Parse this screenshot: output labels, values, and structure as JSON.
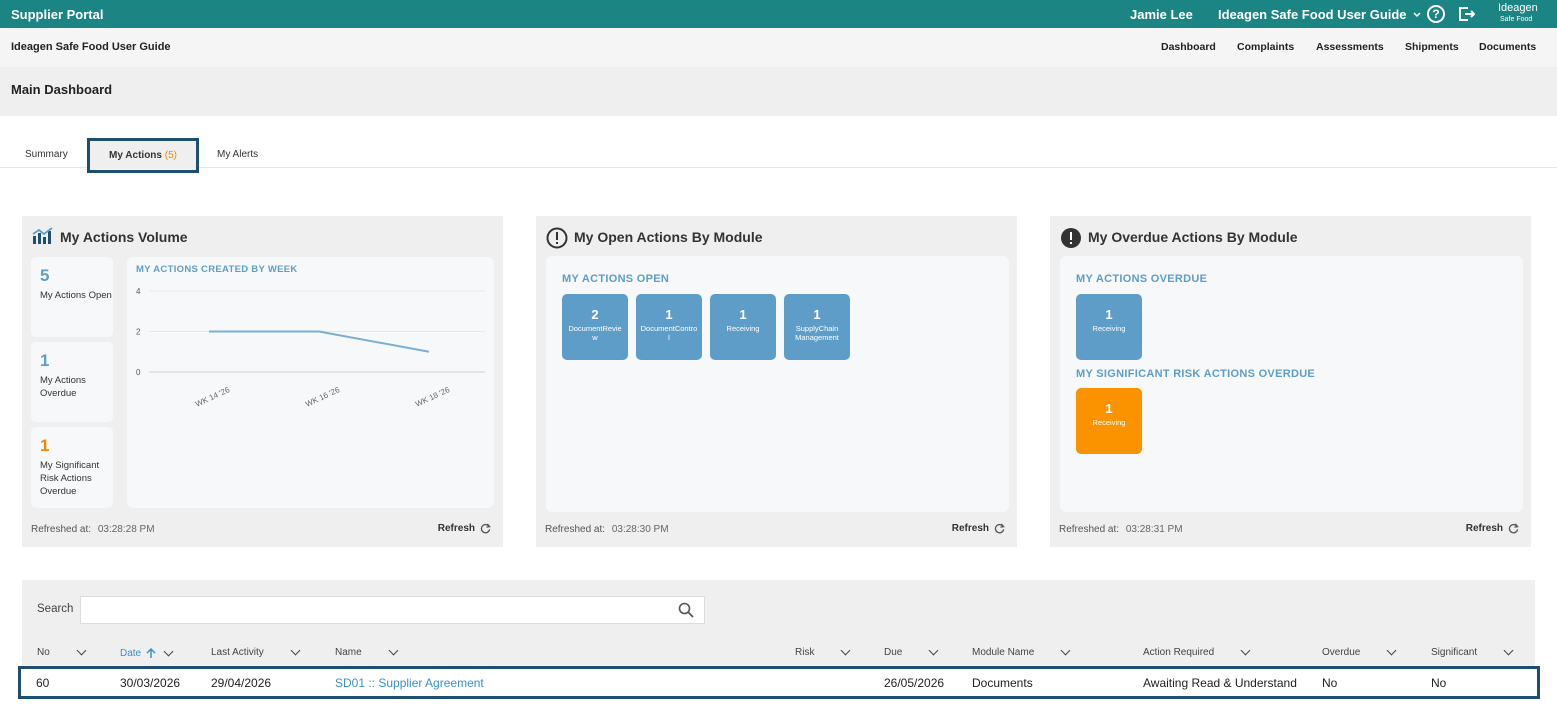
{
  "topbar": {
    "brand": "Supplier Portal",
    "user": "Jamie Lee",
    "site_selector": "Ideagen Safe Food User Guide",
    "help_glyph": "?",
    "logo_main": "Ideagen",
    "logo_sub": "Safe Food"
  },
  "subheader": {
    "site": "Ideagen Safe Food User Guide",
    "nav": [
      "Dashboard",
      "Complaints",
      "Assessments",
      "Shipments",
      "Documents"
    ]
  },
  "page_title": "Main Dashboard",
  "tabs": {
    "summary": "Summary",
    "my_actions": "My Actions",
    "my_actions_count": "(5)",
    "my_alerts": "My Alerts"
  },
  "volume_panel": {
    "title": "My Actions Volume",
    "stats": [
      {
        "value": "5",
        "label": "My Actions Open"
      },
      {
        "value": "1",
        "label": "My Actions Overdue"
      },
      {
        "value": "1",
        "label": "My Significant Risk Actions Overdue"
      }
    ],
    "refreshed_label": "Refreshed at:",
    "refreshed_time": "03:28:28 PM",
    "refresh": "Refresh"
  },
  "chart_data": {
    "type": "line",
    "title": "MY ACTIONS CREATED BY WEEK",
    "categories": [
      "WK 14 '26",
      "WK 16 '26",
      "WK 18 '26"
    ],
    "values": [
      2,
      2,
      1
    ],
    "yticks": [
      0,
      2,
      4
    ],
    "ylim": [
      0,
      4
    ],
    "grid": true,
    "color": "#7aaed3"
  },
  "open_panel": {
    "title": "My Open Actions By Module",
    "section": "MY ACTIONS OPEN",
    "tiles": [
      {
        "value": "2",
        "label": "DocumentReview"
      },
      {
        "value": "1",
        "label": "DocumentControl"
      },
      {
        "value": "1",
        "label": "Receiving"
      },
      {
        "value": "1",
        "label": "SupplyChain Management"
      }
    ],
    "refreshed_label": "Refreshed at:",
    "refreshed_time": "03:28:30 PM",
    "refresh": "Refresh"
  },
  "overdue_panel": {
    "title": "My Overdue Actions By Module",
    "section_overdue": "MY ACTIONS OVERDUE",
    "overdue_tile": {
      "value": "1",
      "label": "Receiving"
    },
    "section_sig": "MY SIGNIFICANT RISK ACTIONS OVERDUE",
    "sig_tile": {
      "value": "1",
      "label": "Receiving"
    },
    "refreshed_label": "Refreshed at:",
    "refreshed_time": "03:28:31 PM",
    "refresh": "Refresh"
  },
  "table": {
    "search_label": "Search",
    "search_value": "",
    "columns": [
      "No",
      "Date",
      "Last Activity",
      "Name",
      "Risk",
      "Due",
      "Module Name",
      "Action Required",
      "Overdue",
      "Significant"
    ],
    "rows": [
      [
        "60",
        "30/03/2026",
        "29/04/2026",
        "SD01 :: Supplier Agreement",
        "",
        "26/05/2026",
        "Documents",
        "Awaiting Read & Understand",
        "No",
        "No"
      ]
    ]
  },
  "colors": {
    "topbar": "#1b8584",
    "accent_blue": "#5e9dc8",
    "accent_orange": "#fb9300",
    "highlight_border": "#1e4f6e"
  }
}
